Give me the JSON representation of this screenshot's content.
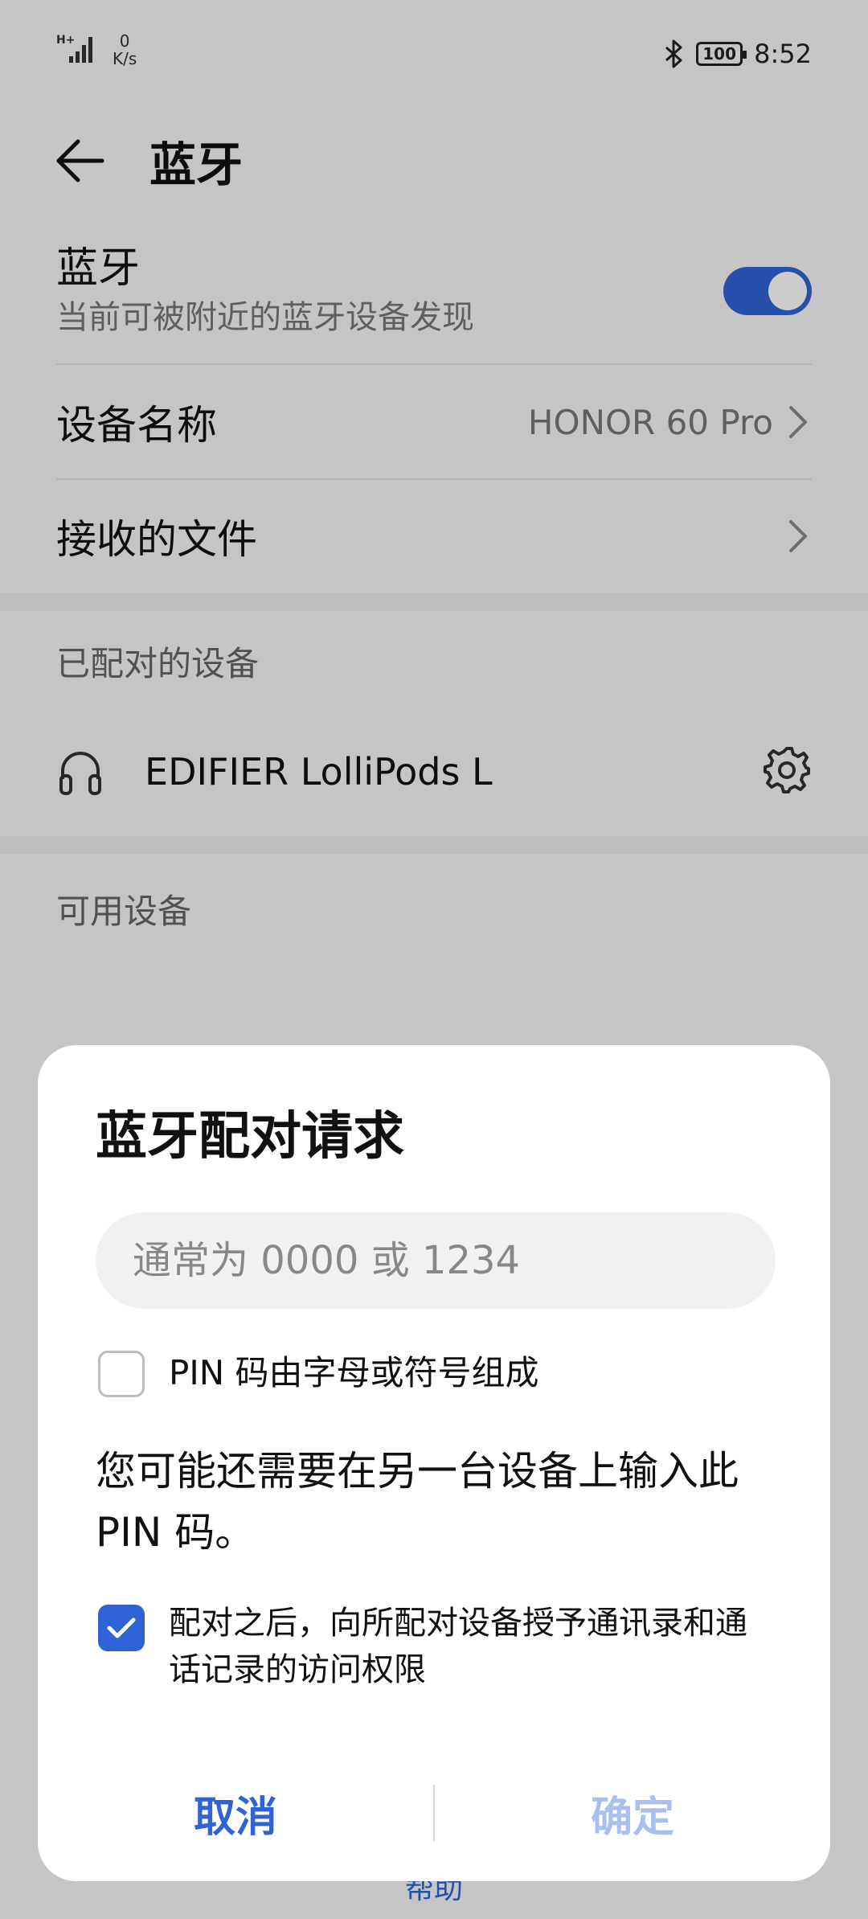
{
  "status_bar": {
    "signal": "H+",
    "net_speed_value": "0",
    "net_speed_unit": "K/s",
    "battery": "100",
    "time": "8:52"
  },
  "app_bar": {
    "title": "蓝牙"
  },
  "bluetooth": {
    "label": "蓝牙",
    "subtitle": "当前可被附近的蓝牙设备发现",
    "enabled": true
  },
  "device_name": {
    "label": "设备名称",
    "value": "HONOR 60 Pro"
  },
  "received_files": {
    "label": "接收的文件"
  },
  "paired_section": {
    "title": "已配对的设备",
    "devices": [
      {
        "name": "EDIFIER LolliPods L"
      }
    ]
  },
  "available_section": {
    "title": "可用设备"
  },
  "help_link": "帮助",
  "dialog": {
    "title": "蓝牙配对请求",
    "pin_placeholder": "通常为 0000 或 1234",
    "pin_letters_label": "PIN 码由字母或符号组成",
    "pin_letters_checked": false,
    "note": "您可能还需要在另一台设备上输入此 PIN 码。",
    "share_contacts_label": "配对之后，向所配对设备授予通讯录和通话记录的访问权限",
    "share_contacts_checked": true,
    "cancel_label": "取消",
    "ok_label": "确定"
  },
  "colors": {
    "accent": "#2f63d6",
    "accent_disabled": "#a9c0ef"
  }
}
